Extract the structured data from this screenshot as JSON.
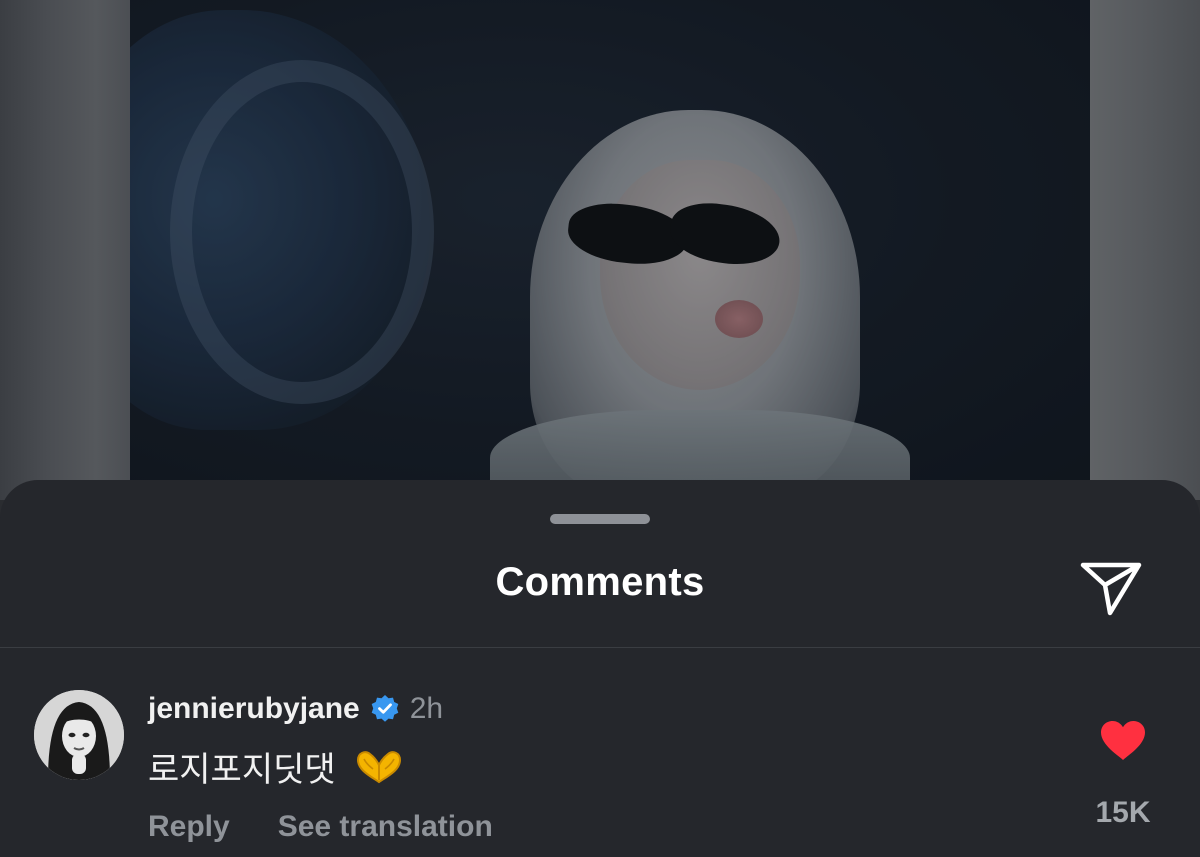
{
  "sheet": {
    "title": "Comments",
    "share_icon": "send-icon"
  },
  "comment": {
    "username": "jennierubyjane",
    "verified_icon": "verified-badge-icon",
    "time": "2h",
    "text": "로지포지딧댓",
    "emoji_icon": "heart-hands-icon",
    "actions": {
      "reply": "Reply",
      "translate": "See translation"
    },
    "like_icon": "heart-filled-icon",
    "like_count": "15K"
  },
  "colors": {
    "sheet_bg": "#25272c",
    "verified": "#3897f0",
    "like": "#ff3040",
    "muted_text": "#8f9399"
  }
}
